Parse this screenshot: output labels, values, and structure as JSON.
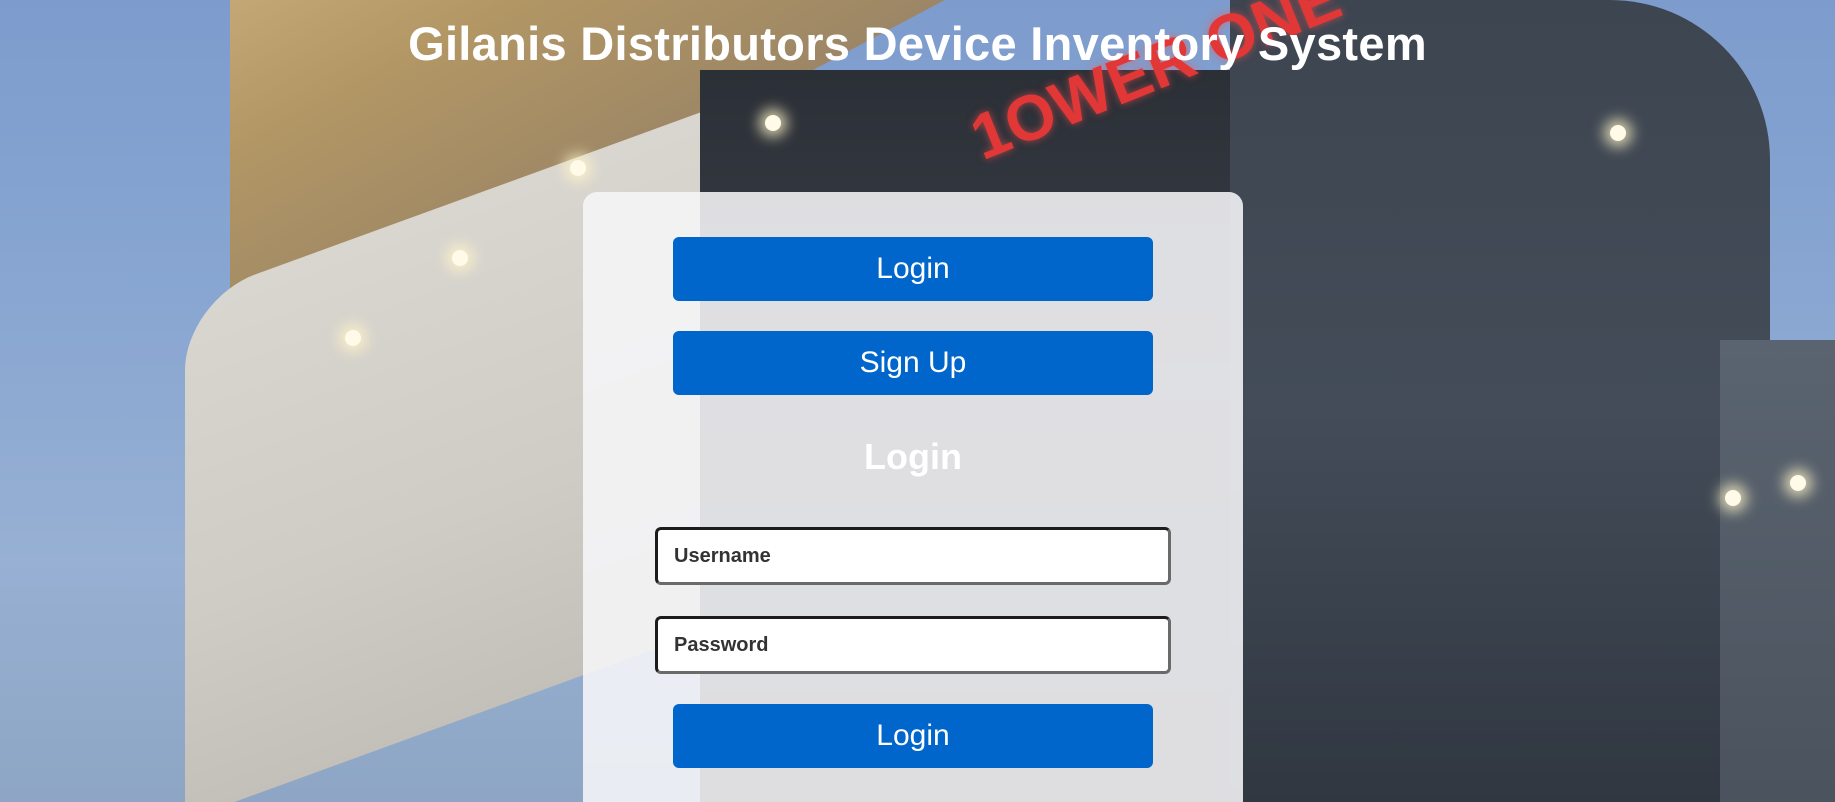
{
  "header": {
    "title": "Gilanis Distributors Device Inventory System"
  },
  "auth_card": {
    "login_tab_label": "Login",
    "signup_tab_label": "Sign Up",
    "form_heading": "Login",
    "username": {
      "placeholder": "Username",
      "value": ""
    },
    "password": {
      "placeholder": "Password",
      "value": ""
    },
    "submit_label": "Login"
  },
  "background": {
    "sign_text": "1OWER ONE"
  },
  "colors": {
    "primary_button": "#0066cc",
    "title_text": "#ffffff",
    "card_background": "#f6f6f8"
  }
}
